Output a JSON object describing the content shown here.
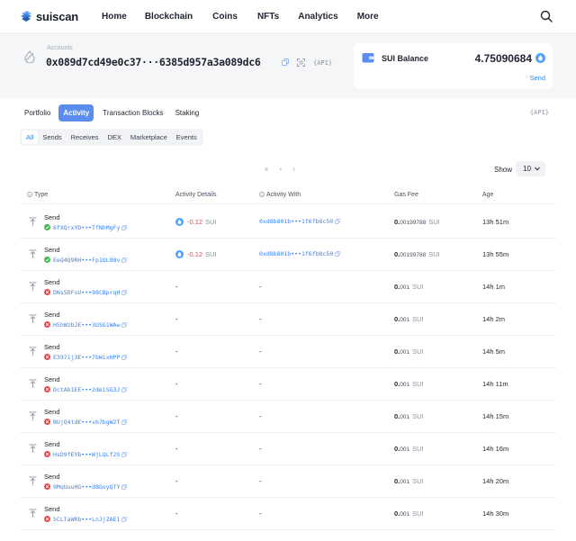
{
  "nav": {
    "logo_text": "suiscan",
    "items": [
      "Home",
      "Blockchain",
      "Coins",
      "NFTs",
      "Analytics",
      "More"
    ]
  },
  "account": {
    "label": "Accounts",
    "address": "0x089d7cd49e0c37···6385d957a3a089dc6",
    "api": "{API}"
  },
  "balance": {
    "label": "SUI Balance",
    "value": "4.75090684",
    "send": "Send"
  },
  "tabs": [
    "Portfolio",
    "Activity",
    "Transaction Blocks",
    "Staking"
  ],
  "active_tab": "Activity",
  "tabs_api": "{API}",
  "filters": [
    "All",
    "Sends",
    "Receives",
    "DEX",
    "Marketplace",
    "Events"
  ],
  "active_filter": "All",
  "pager": {
    "first": "«",
    "prev": "‹",
    "next": "›"
  },
  "show": {
    "label": "Show",
    "value": "10"
  },
  "table": {
    "headers": {
      "type": "Type",
      "details": "Activity Details",
      "with": "Activity With",
      "gas": "Gas Fee",
      "age": "Age"
    },
    "rows": [
      {
        "type": "Send",
        "status": "success",
        "digest": "6fXQrxYD•••TfNhMgFy",
        "amount": "-0.12",
        "symbol": "SUI",
        "with": "0xd8b801b•••1f6fb8c50",
        "gas_int": "0.",
        "gas_frac": "00199788",
        "gas_sym": "SUI",
        "age": "13h 51m"
      },
      {
        "type": "Send",
        "status": "success",
        "digest": "EeQ4Q9RH•••Fp1QL98v",
        "amount": "-0.12",
        "symbol": "SUI",
        "with": "0xd8b801b•••1f6fb8c50",
        "gas_int": "0.",
        "gas_frac": "00199788",
        "gas_sym": "SUI",
        "age": "13h 55m"
      },
      {
        "type": "Send",
        "status": "failed",
        "digest": "DNs5DFsU•••98CBprqH",
        "amount": "",
        "symbol": "",
        "with": "",
        "gas_int": "0.",
        "gas_frac": "001",
        "gas_sym": "SUI",
        "age": "14h 1m"
      },
      {
        "type": "Send",
        "status": "failed",
        "digest": "HShWzbJE•••3USG1WAw",
        "amount": "",
        "symbol": "",
        "with": "",
        "gas_int": "0.",
        "gas_frac": "001",
        "gas_sym": "SUI",
        "age": "14h 2m"
      },
      {
        "type": "Send",
        "status": "failed",
        "digest": "E3971j3E•••7bWixHPP",
        "amount": "",
        "symbol": "",
        "with": "",
        "gas_int": "0.",
        "gas_frac": "001",
        "gas_sym": "SUI",
        "age": "14h 5m"
      },
      {
        "type": "Send",
        "status": "failed",
        "digest": "DctAb1EE•••2deiSG3J",
        "amount": "",
        "symbol": "",
        "with": "",
        "gas_int": "0.",
        "gas_frac": "001",
        "gas_sym": "SUI",
        "age": "14h 11m"
      },
      {
        "type": "Send",
        "status": "failed",
        "digest": "BUjQ4tdE•••vb7bgW2T",
        "amount": "",
        "symbol": "",
        "with": "",
        "gas_int": "0.",
        "gas_frac": "001",
        "gas_sym": "SUI",
        "age": "14h 15m"
      },
      {
        "type": "Send",
        "status": "failed",
        "digest": "HsD9fEYb•••WjLQLf2S",
        "amount": "",
        "symbol": "",
        "with": "",
        "gas_int": "0.",
        "gas_frac": "001",
        "gas_sym": "SUI",
        "age": "14h 16m"
      },
      {
        "type": "Send",
        "status": "failed",
        "digest": "9MqUuuHG•••d8GoyQTY",
        "amount": "",
        "symbol": "",
        "with": "",
        "gas_int": "0.",
        "gas_frac": "001",
        "gas_sym": "SUI",
        "age": "14h 20m"
      },
      {
        "type": "Send",
        "status": "failed",
        "digest": "5CLTaWRb•••LnJjZAE1",
        "amount": "",
        "symbol": "",
        "with": "",
        "gas_int": "0.",
        "gas_frac": "001",
        "gas_sym": "SUI",
        "age": "14h 30m"
      }
    ],
    "dash": "-"
  },
  "colors": {
    "accent": "#5b8def",
    "link": "#3b82f6",
    "negative": "#e5484d",
    "success": "#3fb950",
    "failed": "#e5484d"
  }
}
